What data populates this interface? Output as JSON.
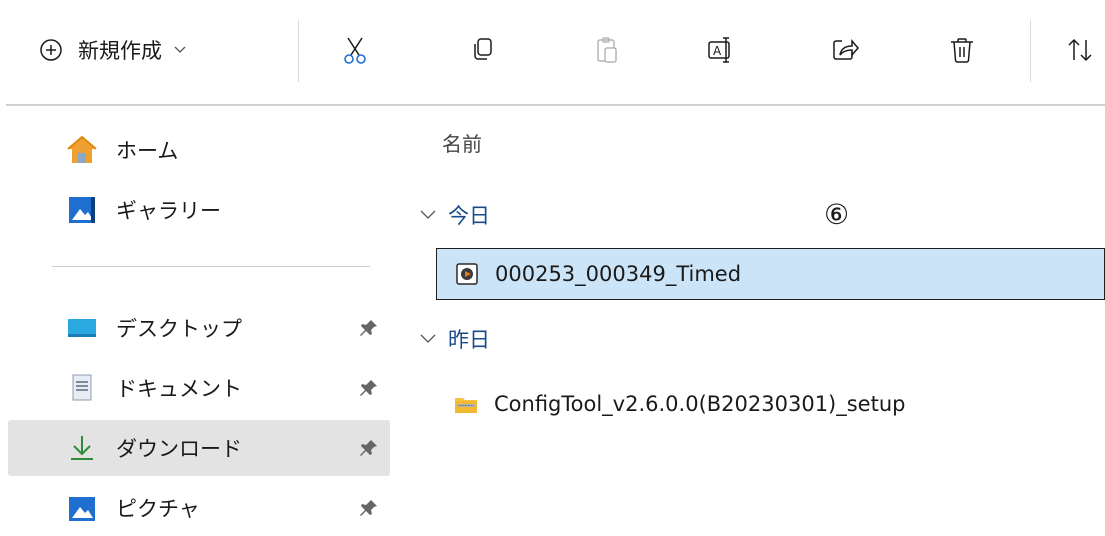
{
  "toolbar": {
    "new_label": "新規作成",
    "buttons": [
      "cut",
      "copy",
      "paste",
      "rename",
      "share",
      "delete",
      "sort"
    ]
  },
  "nav": {
    "quick": [
      {
        "label": "ホーム",
        "icon": "home-icon"
      },
      {
        "label": "ギャラリー",
        "icon": "gallery-icon"
      }
    ],
    "pinned": [
      {
        "label": "デスクトップ",
        "icon": "desktop-icon"
      },
      {
        "label": "ドキュメント",
        "icon": "documents-icon"
      },
      {
        "label": "ダウンロード",
        "icon": "downloads-icon",
        "selected": true
      },
      {
        "label": "ピクチャ",
        "icon": "pictures-icon"
      }
    ]
  },
  "content": {
    "column_header": "名前",
    "annotation": "⑥",
    "groups": [
      {
        "label": "今日",
        "files": [
          {
            "name": "000253_000349_Timed",
            "icon": "media-file-icon",
            "selected": true
          }
        ]
      },
      {
        "label": "昨日",
        "files": [
          {
            "name": "ConfigTool_v2.6.0.0(B20230301)_setup",
            "icon": "zip-folder-icon"
          }
        ]
      }
    ]
  },
  "colors": {
    "selection_bg": "#cce4f7",
    "nav_selected_bg": "#e3e3e3",
    "group_label": "#1a4a8a",
    "accent_green": "#2e8b3a"
  }
}
